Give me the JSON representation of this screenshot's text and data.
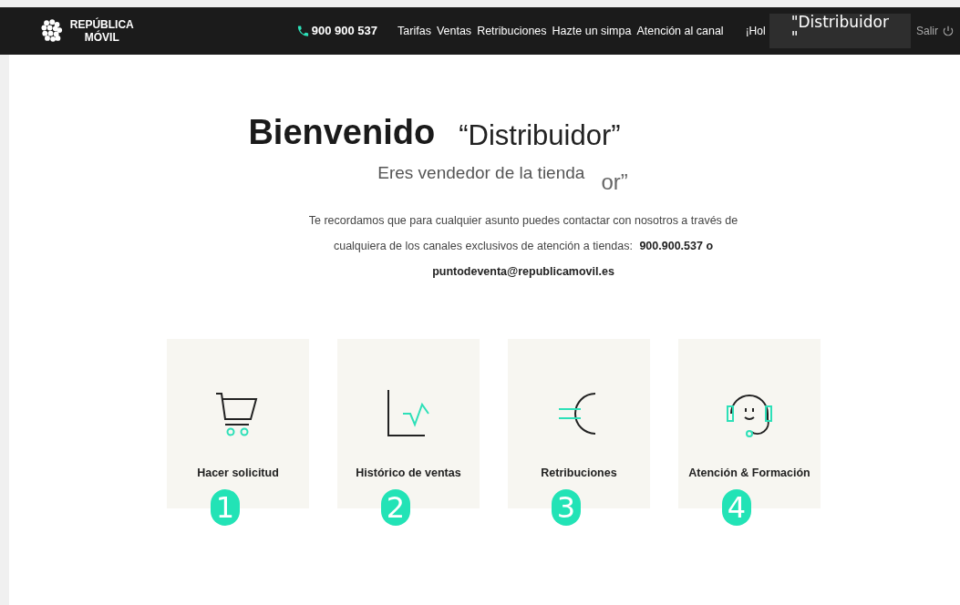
{
  "nav": {
    "logo": [
      "REPÚBLICA",
      "MÓVIL"
    ],
    "phone": "900 900 537",
    "links": [
      "Tarifas",
      "Ventas",
      "Retribuciones",
      "Hazte un simpa",
      "Atención al canal"
    ],
    "greeting": "¡Hol",
    "user_box": [
      "\"Distribuidor",
      "\""
    ],
    "logout": "Salir"
  },
  "welcome": {
    "title": "Bienvenido",
    "name": "“Distribuidor”",
    "store_label": "Eres vendedor de la tienda",
    "store_name": "or”"
  },
  "notice": {
    "text": "Te recordamos que para cualquier asunto puedes contactar con nosotros a través de cualquiera de los canales exclusivos de atención a tiendas:",
    "phone": "900.900.537",
    "joiner": "o",
    "email": "puntodeventa@republicamovil.es"
  },
  "cards": [
    {
      "kind": "cart",
      "label": "Hacer solicitud",
      "badge": "1"
    },
    {
      "kind": "chart",
      "label": "Histórico de ventas",
      "badge": "2"
    },
    {
      "kind": "euro",
      "label": "Retribuciones",
      "badge": "3"
    },
    {
      "kind": "support",
      "label": "Atención & Formación",
      "badge": "4"
    }
  ]
}
